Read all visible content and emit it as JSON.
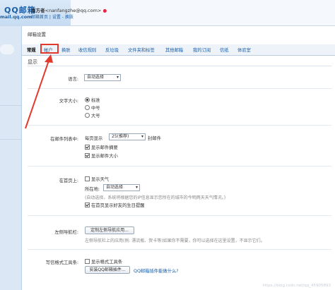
{
  "header": {
    "logo_text": "QQ邮箱",
    "logo_sub": "mail.qq.com",
    "user_name": "南方者",
    "user_email": "<nanfangzhe@qq.com>",
    "links": "邮箱首页 | 设置 - 换肤"
  },
  "panel": {
    "title": "邮箱设置",
    "tabs": [
      "常规",
      "帐户",
      "换肤",
      "收信规则",
      "反垃圾",
      "文件夹和标签",
      "其他邮箱",
      "我的订阅",
      "信纸",
      "体验室"
    ],
    "section": "显示"
  },
  "language": {
    "label": "语言:",
    "value": "自动选择"
  },
  "font_size": {
    "label": "文字大小:",
    "options": [
      "标准",
      "中号",
      "大号"
    ],
    "selected": 0
  },
  "mail_list": {
    "label": "在邮件列表中:",
    "per_page_prefix": "每页显示",
    "per_page_value": "25(推荐)",
    "per_page_suffix": "封邮件",
    "show_summary": "显示邮件摘要",
    "show_sender": "显示邮件大小"
  },
  "home": {
    "label": "在首页上:",
    "weather": "显示天气",
    "location_label": "所在地:",
    "location_value": "自动选择",
    "location_hint": "(自动选择，系统将根据您的IP信息显示您所在的城市的今明两天天气情况。)",
    "birthday": "在首页显示好友的生日提醒"
  },
  "nav": {
    "label": "左侧导航栏:",
    "button": "定制左侧导航应用...",
    "hint": "左侧导航栏上的应用(例: 漂流瓶、贺卡等)如果你不需要，你可以选择在这里设置，不显示它们。"
  },
  "toolbar": {
    "label": "写信格式工具条:",
    "show_toolbar": "显示格式工具条",
    "install_button": "安装QQ邮箱插件...",
    "link": "QQ邮箱插件能做什么?"
  },
  "watermark": "https://blog.csdn.net/qq_45905893"
}
